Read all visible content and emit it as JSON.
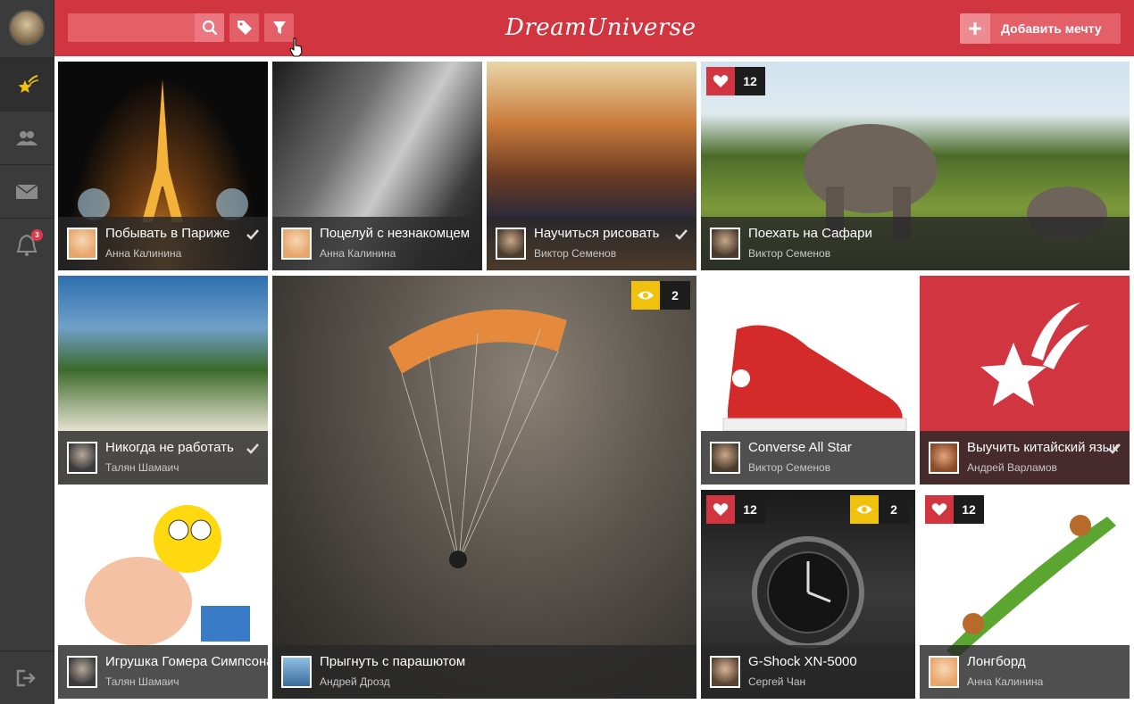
{
  "app": {
    "logo": "DreamUniverse"
  },
  "header": {
    "search_placeholder": "",
    "add_button_label": "Добавить мечту"
  },
  "sidebar": {
    "notifications_count": "3",
    "items": [
      "dreams-icon",
      "friends-icon",
      "messages-icon",
      "notifications-icon",
      "logout-icon"
    ]
  },
  "dreams": [
    {
      "title": "Побывать в Париже",
      "author": "Анна Калинина",
      "done": true
    },
    {
      "title": "Поцелуй с незнакомцем",
      "author": "Анна Калинина",
      "done": false
    },
    {
      "title": "Научиться рисовать",
      "author": "Виктор Семенов",
      "done": true
    },
    {
      "title": "Поехать на Сафари",
      "author": "Виктор Семенов",
      "done": false,
      "likes": "12"
    },
    {
      "title": "Никогда не работать",
      "author": "Талян Шамаич",
      "done": true
    },
    {
      "title": "",
      "author": "",
      "done": false,
      "views": "2"
    },
    {
      "title": "Converse All Star",
      "author": "Виктор Семенов",
      "done": false
    },
    {
      "title": "Выучить китайский язык",
      "author": "Андрей Варламов",
      "done": true
    },
    {
      "title": "Игрушка Гомера Симпсона",
      "author": "Талян Шамаич",
      "done": false
    },
    {
      "title": "Прыгнуть с парашютом",
      "author": "Андрей Дрозд",
      "done": false
    },
    {
      "title": "G-Shock XN-5000",
      "author": "Сергей Чан",
      "done": false,
      "likes": "12",
      "views": "2"
    },
    {
      "title": "Лонгборд",
      "author": "Анна Калинина",
      "done": false,
      "likes": "12"
    }
  ],
  "colors": {
    "brand": "#d1353f",
    "sidebar": "#3b3b3b",
    "view_badge": "#f0c20e"
  }
}
